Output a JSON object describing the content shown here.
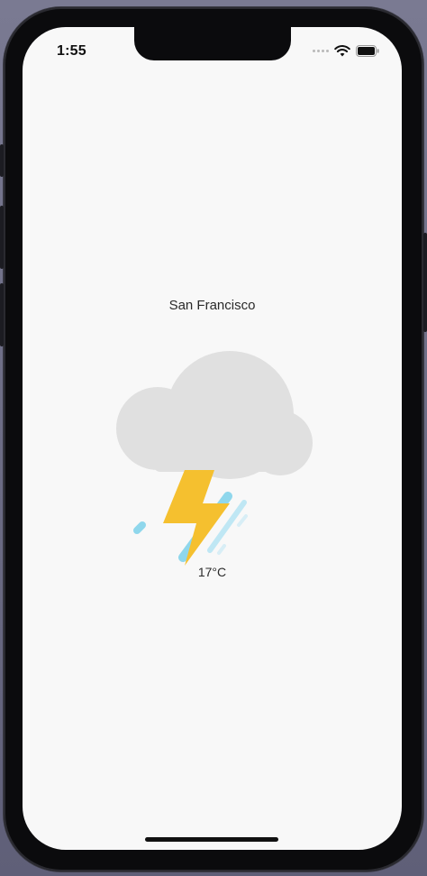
{
  "status_bar": {
    "time": "1:55",
    "wifi_icon": "wifi-icon",
    "battery_icon": "battery-icon",
    "signal_icon": "signal-dots-icon"
  },
  "weather": {
    "city": "San Francisco",
    "temperature": "17°C",
    "condition_icon": "thunderstorm-rain-icon"
  },
  "colors": {
    "screen_bg": "#f8f8f8",
    "cloud": "#e0e0e0",
    "lightning": "#f5c02f",
    "rain": "#8fd7ec"
  }
}
